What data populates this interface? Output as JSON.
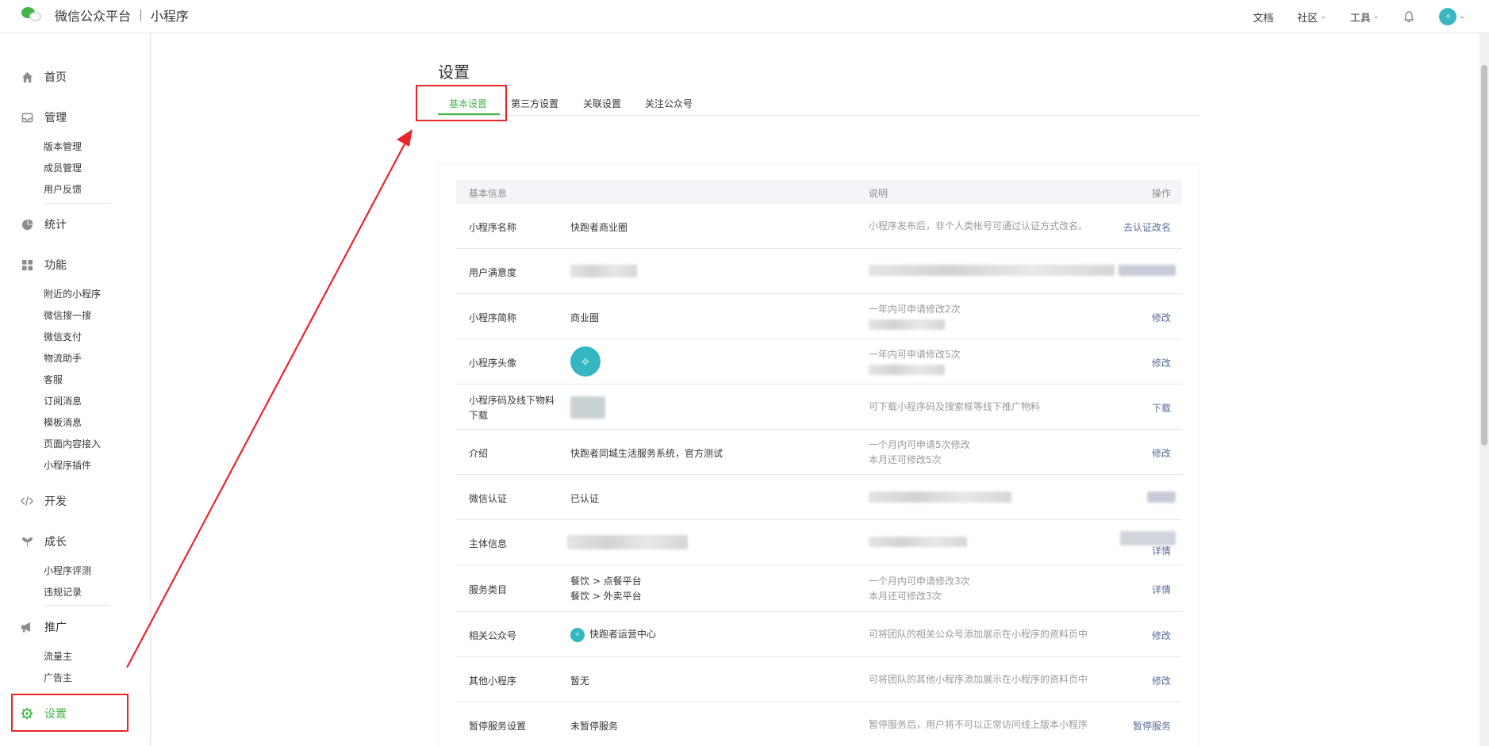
{
  "header": {
    "brand": "微信公众平台",
    "separator": "|",
    "product": "小程序",
    "nav": {
      "docs": "文档",
      "community": "社区",
      "tools": "工具"
    },
    "icons": [
      "wechat-logo-icon",
      "bell-icon",
      "chevron-down-icon"
    ]
  },
  "sidebar": {
    "home": "首页",
    "manage": {
      "label": "管理",
      "items": [
        "版本管理",
        "成员管理",
        "用户反馈"
      ]
    },
    "stats": "统计",
    "features": {
      "label": "功能",
      "items": [
        "附近的小程序",
        "微信搜一搜",
        "微信支付",
        "物流助手",
        "客服",
        "订阅消息",
        "模板消息",
        "页面内容接入",
        "小程序插件"
      ]
    },
    "develop": "开发",
    "growth": {
      "label": "成长",
      "items": [
        "小程序评测",
        "违规记录"
      ]
    },
    "promote": {
      "label": "推广",
      "items": [
        "流量主",
        "广告主"
      ]
    },
    "settings": "设置"
  },
  "main": {
    "title": "设置",
    "tabs": [
      "基本设置",
      "第三方设置",
      "关联设置",
      "关注公众号"
    ],
    "active_tab": "基本设置",
    "table": {
      "headers": {
        "info": "基本信息",
        "desc": "说明",
        "action": "操作"
      },
      "rows": [
        {
          "label": "小程序名称",
          "value": "快跑者商业圈",
          "desc": "小程序发布后，非个人类帐号可通过认证方式改名。",
          "action": "去认证改名"
        },
        {
          "label": "用户满意度",
          "value": "",
          "desc": "",
          "action": ""
        },
        {
          "label": "小程序简称",
          "value": "商业圈",
          "desc": "一年内可申请修改2次",
          "action": "修改"
        },
        {
          "label": "小程序头像",
          "value": "",
          "desc": "一年内可申请修改5次",
          "action": "修改"
        },
        {
          "label": "小程序码及线下物料下载",
          "value": "",
          "desc": "可下载小程序码及搜索框等线下推广物料",
          "action": "下载"
        },
        {
          "label": "介绍",
          "value": "快跑者同城生活服务系统，官方测试",
          "desc": "一个月内可申请5次修改",
          "desc2": "本月还可修改5次",
          "action": "修改"
        },
        {
          "label": "微信认证",
          "value": "已认证",
          "desc": "",
          "action": ""
        },
        {
          "label": "主体信息",
          "value": "",
          "desc": "",
          "action": "详情"
        },
        {
          "label": "服务类目",
          "value": "餐饮 > 点餐平台",
          "value2": "餐饮 > 外卖平台",
          "desc": "一个月内可申请修改3次",
          "desc2": "本月还可修改3次",
          "action": "详情"
        },
        {
          "label": "相关公众号",
          "value": "快跑者运营中心",
          "desc": "可将团队的相关公众号添加展示在小程序的资料页中",
          "action": "修改"
        },
        {
          "label": "其他小程序",
          "value": "暂无",
          "desc": "可将团队的其他小程序添加展示在小程序的资料页中",
          "action": "修改"
        },
        {
          "label": "暂停服务设置",
          "value": "未暂停服务",
          "desc": "暂停服务后，用户将不可以正常访问线上版本小程序",
          "action": "暂停服务"
        }
      ]
    }
  },
  "annotation_color": "#e8262b",
  "accent_color": "#44b549",
  "link_color": "#576b95"
}
